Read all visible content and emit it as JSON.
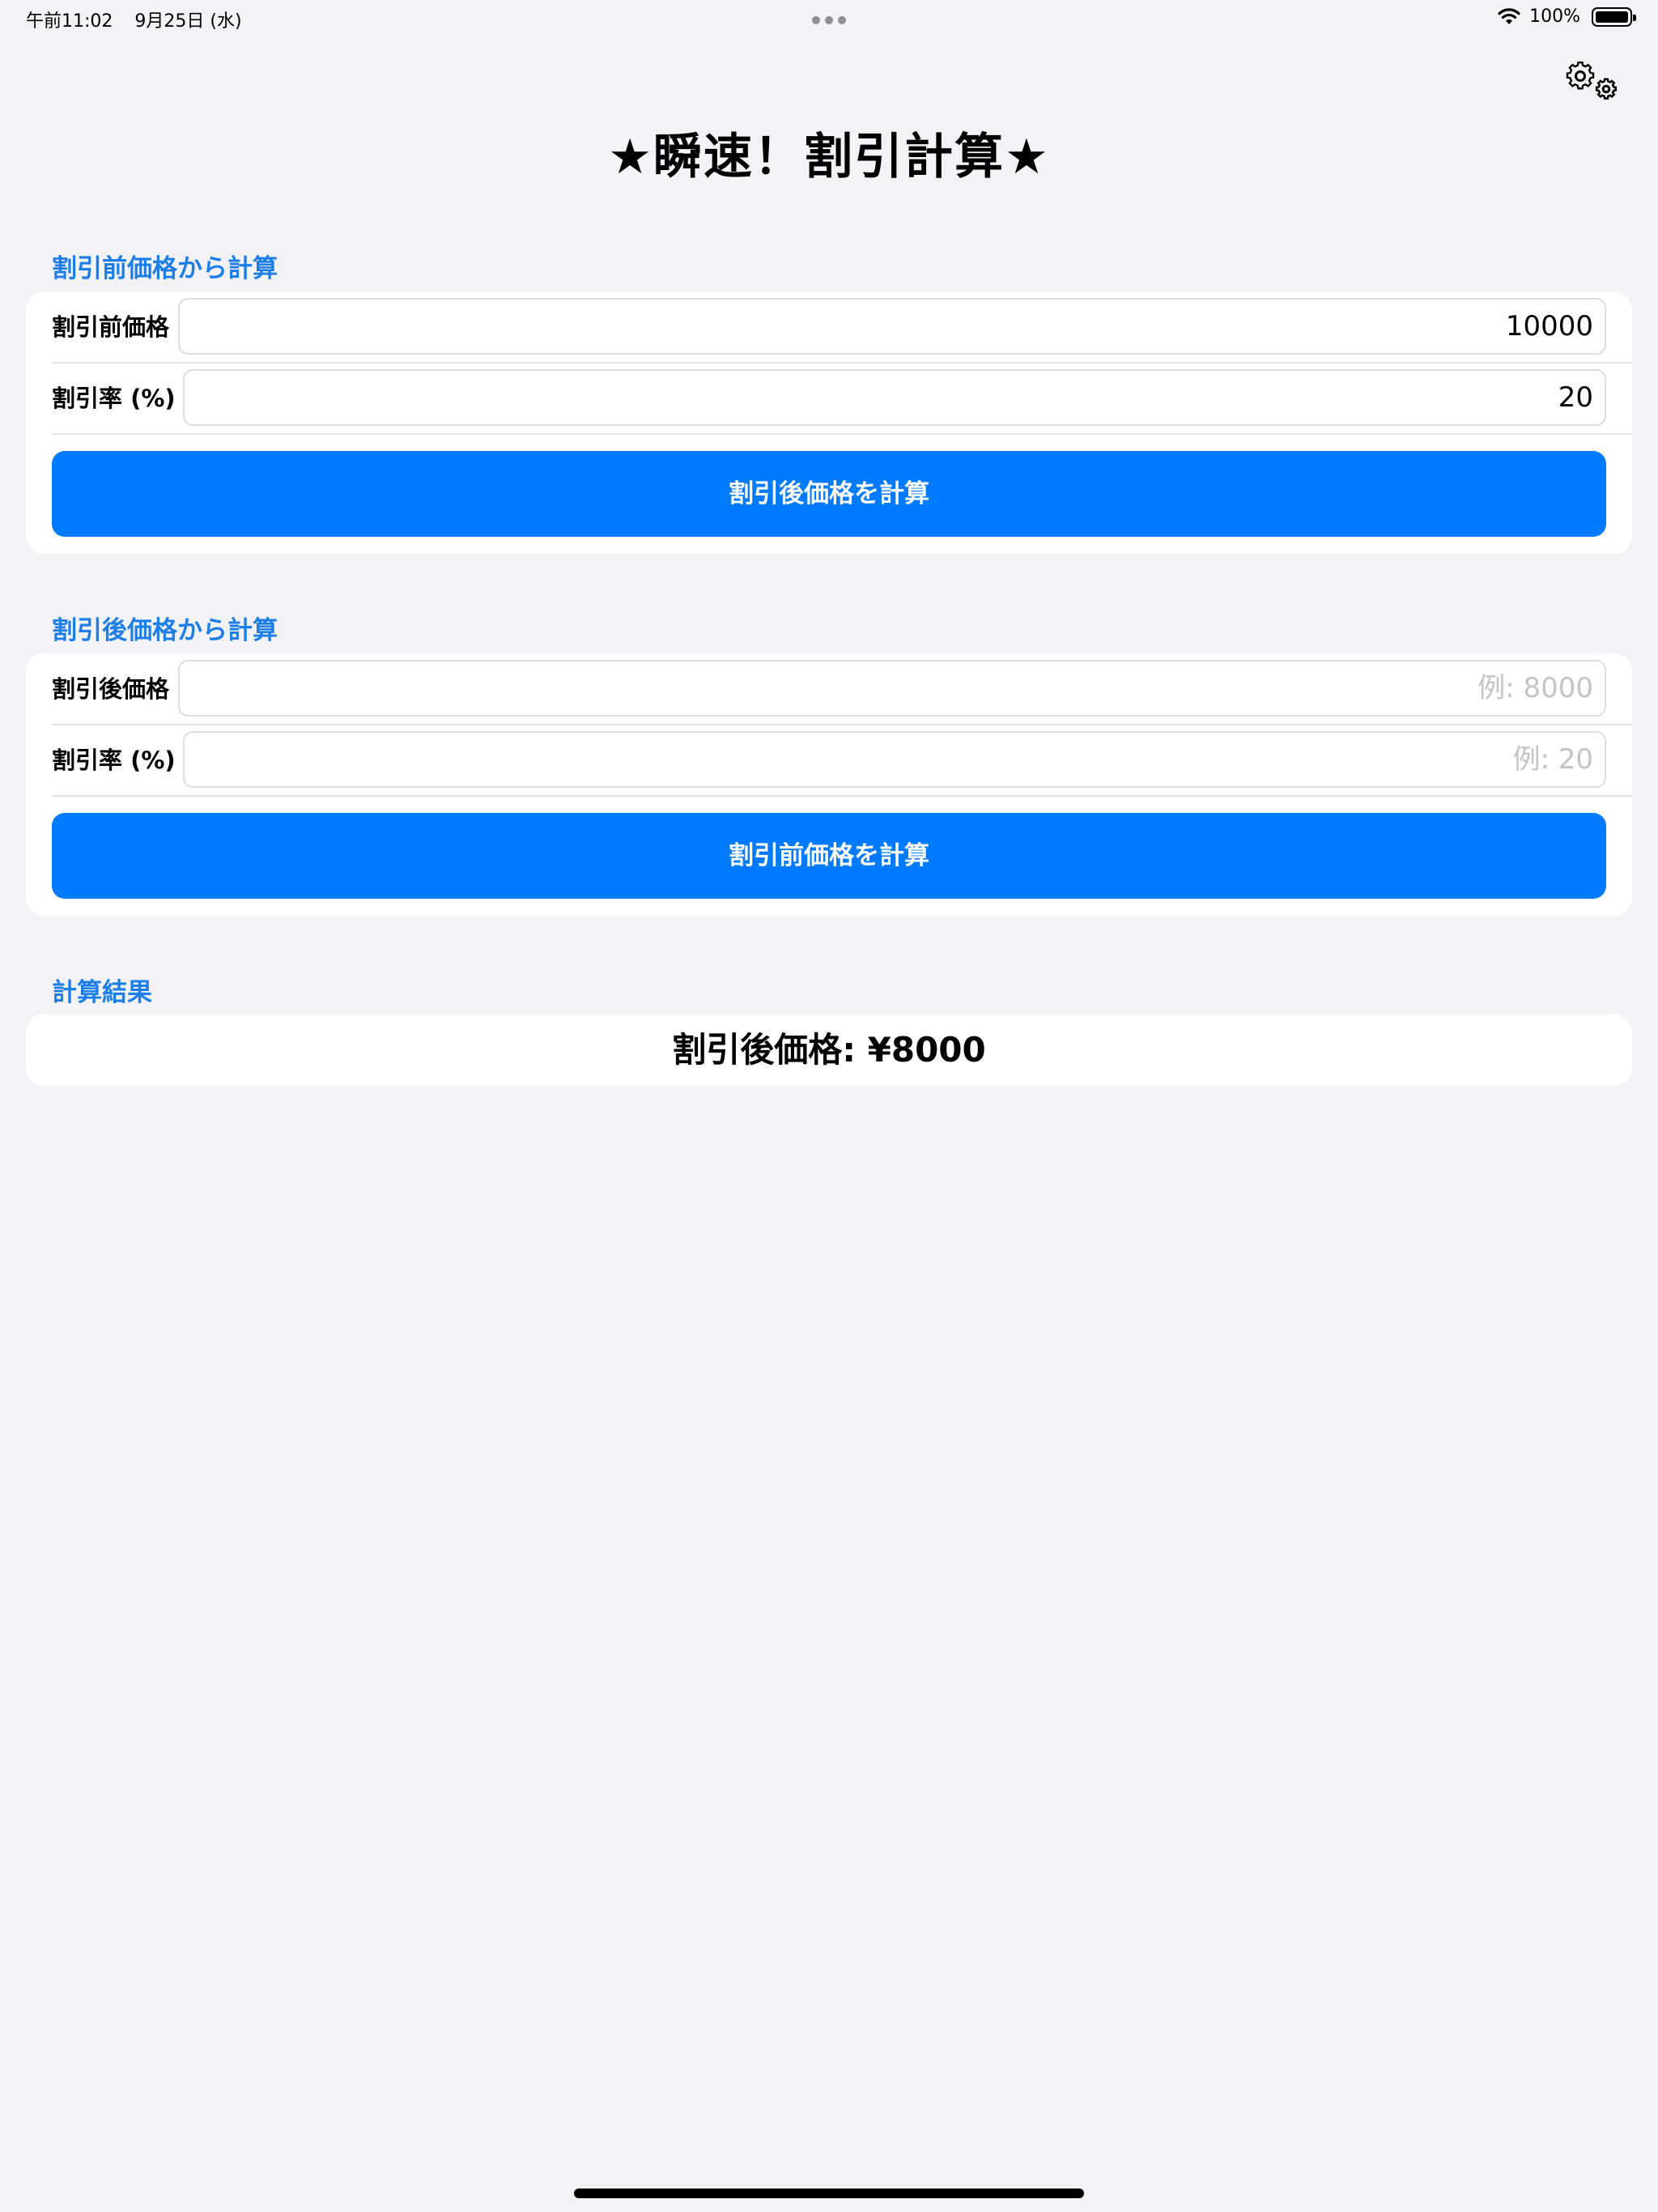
{
  "status_bar": {
    "time": "午前11:02",
    "date": "9月25日 (水)",
    "battery_percent": "100%",
    "battery_level": 1.0
  },
  "icons": {
    "settings": "gear-icon",
    "wifi": "wifi-icon",
    "battery": "battery-icon"
  },
  "title": "★瞬速！割引計算★",
  "section1": {
    "header": "割引前価格から計算",
    "price_label": "割引前価格",
    "price_value": "10000",
    "rate_label": "割引率 (%)",
    "rate_value": "20",
    "button_label": "割引後価格を計算"
  },
  "section2": {
    "header": "割引後価格から計算",
    "price_label": "割引後価格",
    "price_placeholder": "例: 8000",
    "rate_label": "割引率 (%)",
    "rate_placeholder": "例: 20",
    "button_label": "割引前価格を計算"
  },
  "result": {
    "header": "計算結果",
    "text": "割引後価格: ¥8000"
  },
  "colors": {
    "accent": "#007aff",
    "section_header": "#1c7ee6",
    "background": "#f2f2f7"
  }
}
